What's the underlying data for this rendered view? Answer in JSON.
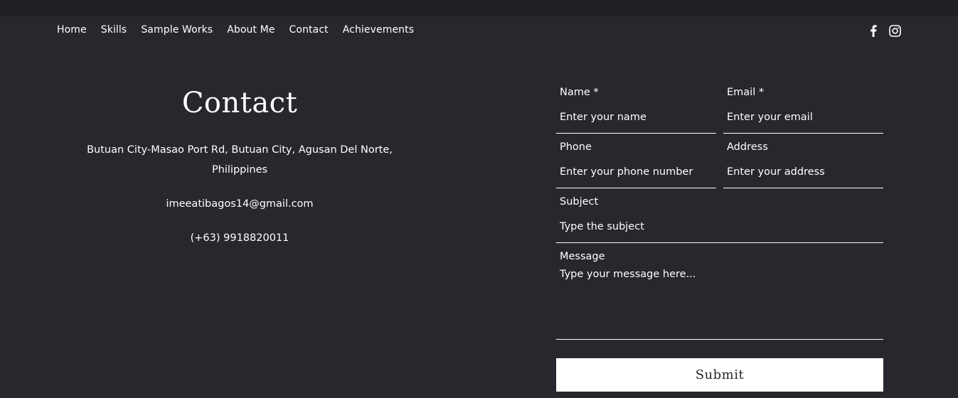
{
  "nav": {
    "items": [
      {
        "label": "Home"
      },
      {
        "label": "Skills"
      },
      {
        "label": "Sample Works"
      },
      {
        "label": "About Me"
      },
      {
        "label": "Contact"
      },
      {
        "label": "Achievements"
      }
    ]
  },
  "social": {
    "facebook_icon": "facebook-icon",
    "instagram_icon": "instagram-icon"
  },
  "contact": {
    "title": "Contact",
    "address": "Butuan City-Masao Port Rd, Butuan City, Agusan Del Norte, Philippines",
    "email": "imeeatibagos14@gmail.com",
    "phone": "(+63) 9918820011"
  },
  "form": {
    "name": {
      "label": "Name *",
      "placeholder": "Enter your name",
      "value": ""
    },
    "email": {
      "label": "Email *",
      "placeholder": "Enter your email",
      "value": ""
    },
    "phone": {
      "label": "Phone",
      "placeholder": "Enter your phone number",
      "value": ""
    },
    "address": {
      "label": "Address",
      "placeholder": "Enter your address",
      "value": ""
    },
    "subject": {
      "label": "Subject",
      "placeholder": "Type the subject",
      "value": ""
    },
    "message": {
      "label": "Message",
      "placeholder": "Type your message here...",
      "value": ""
    },
    "submit_label": "Submit"
  },
  "colors": {
    "background": "#26282d",
    "topbar": "#1f2126",
    "text": "#ffffff",
    "button_bg": "#ffffff"
  }
}
